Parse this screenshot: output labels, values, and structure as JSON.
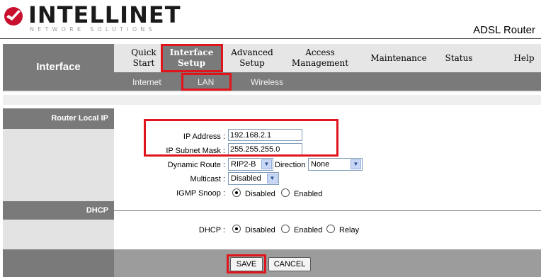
{
  "brand": {
    "logo_text": "INTELLINET",
    "logo_sub": "NETWORK SOLUTIONS",
    "logo_icon": "intellinet-swoosh-icon",
    "model": "ADSL Router"
  },
  "nav": {
    "section_label": "Interface",
    "items": [
      {
        "label_line1": "Quick",
        "label_line2": "Start"
      },
      {
        "label_line1": "Interface",
        "label_line2": "Setup"
      },
      {
        "label_line1": "Advanced",
        "label_line2": "Setup"
      },
      {
        "label_line1": "Access",
        "label_line2": "Management"
      },
      {
        "label_line1": "Maintenance",
        "label_line2": ""
      },
      {
        "label_line1": "Status",
        "label_line2": ""
      },
      {
        "label_line1": "Help",
        "label_line2": ""
      }
    ],
    "active": "Interface Setup",
    "sub_items": [
      "Internet",
      "LAN",
      "Wireless"
    ],
    "active_sub": "LAN"
  },
  "router_local_ip": {
    "section_label": "Router Local IP",
    "ip_address_label": "IP Address :",
    "ip_address_value": "192.168.2.1",
    "subnet_mask_label": "IP Subnet Mask :",
    "subnet_mask_value": "255.255.255.0",
    "dynamic_route_label": "Dynamic Route :",
    "dynamic_route_value": "RIP2-B",
    "direction_label": "Direction",
    "direction_value": "None",
    "multicast_label": "Multicast :",
    "multicast_value": "Disabled",
    "igmp_snoop_label": "IGMP Snoop :",
    "igmp_snoop_options": [
      "Disabled",
      "Enabled"
    ],
    "igmp_snoop_selected": "Disabled"
  },
  "dhcp": {
    "section_label": "DHCP",
    "dhcp_label": "DHCP :",
    "options": [
      "Disabled",
      "Enabled",
      "Relay"
    ],
    "selected": "Disabled"
  },
  "footer": {
    "save_label": "SAVE",
    "cancel_label": "CANCEL"
  },
  "colors": {
    "highlight": "#e0141b",
    "nav_dark": "#7a7a7a",
    "nav_light": "#e6e6e6"
  }
}
